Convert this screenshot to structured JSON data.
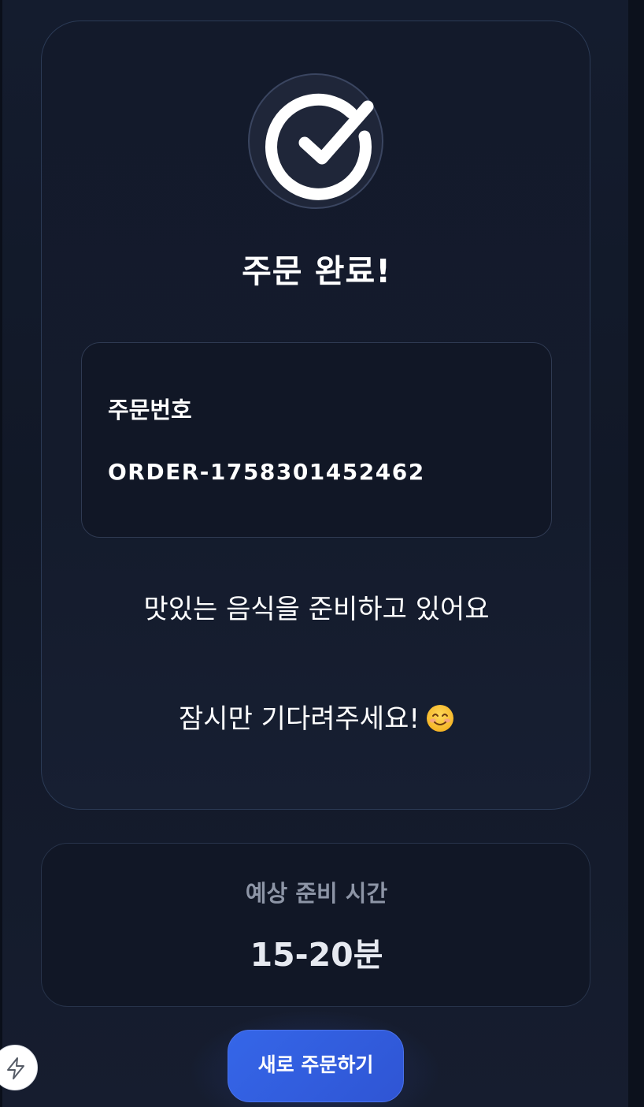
{
  "confirmation": {
    "title": "주문 완료!",
    "order_label": "주문번호",
    "order_number": "ORDER-1758301452462",
    "message_line1": "맛있는 음식을 준비하고 있어요",
    "message_line2": "잠시만 기다려주세요!"
  },
  "prep_time": {
    "label": "예상 준비 시간",
    "value": "15-20분"
  },
  "actions": {
    "new_order_label": "새로 주문하기"
  },
  "icons": {
    "status": "check-circle-icon",
    "emoji": "smiling-face-icon",
    "fab": "lightning-bolt-icon"
  },
  "colors": {
    "background": "#111827",
    "card_border": "#2b3a55",
    "primary_button": "#3566e8",
    "muted_text": "#8d95a6"
  }
}
